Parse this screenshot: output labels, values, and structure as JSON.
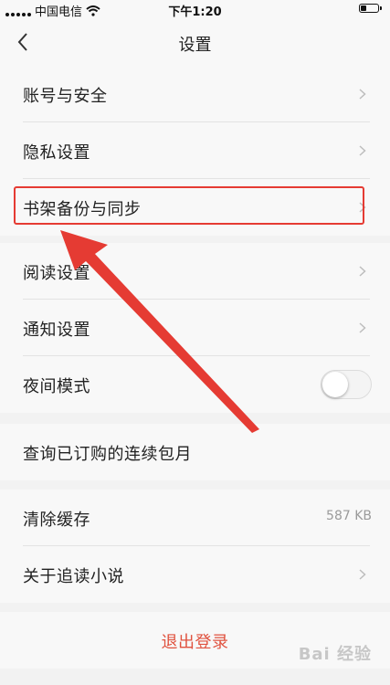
{
  "status_bar": {
    "carrier": "中国电信",
    "time": "下午1:20",
    "battery_level": 0.35
  },
  "nav": {
    "title": "设置",
    "back_icon": "chevron-left-icon"
  },
  "groups": [
    {
      "items": [
        {
          "label": "账号与安全",
          "accessory": "chevron"
        },
        {
          "label": "隐私设置",
          "accessory": "chevron"
        },
        {
          "label": "书架备份与同步",
          "accessory": "chevron"
        }
      ]
    },
    {
      "items": [
        {
          "label": "阅读设置",
          "accessory": "chevron"
        },
        {
          "label": "通知设置",
          "accessory": "chevron"
        },
        {
          "label": "夜间模式",
          "accessory": "toggle",
          "toggle_on": false
        }
      ]
    },
    {
      "items": [
        {
          "label": "查询已订购的连续包月"
        }
      ]
    },
    {
      "items": [
        {
          "label": "清除缓存",
          "value": "587 KB"
        },
        {
          "label": "关于追读小说",
          "accessory": "chevron"
        }
      ]
    }
  ],
  "logout": {
    "label": "退出登录",
    "color": "#e0523f"
  },
  "annotation": {
    "color": "#e53b33"
  },
  "watermark": {
    "text": "Bai 经验"
  }
}
